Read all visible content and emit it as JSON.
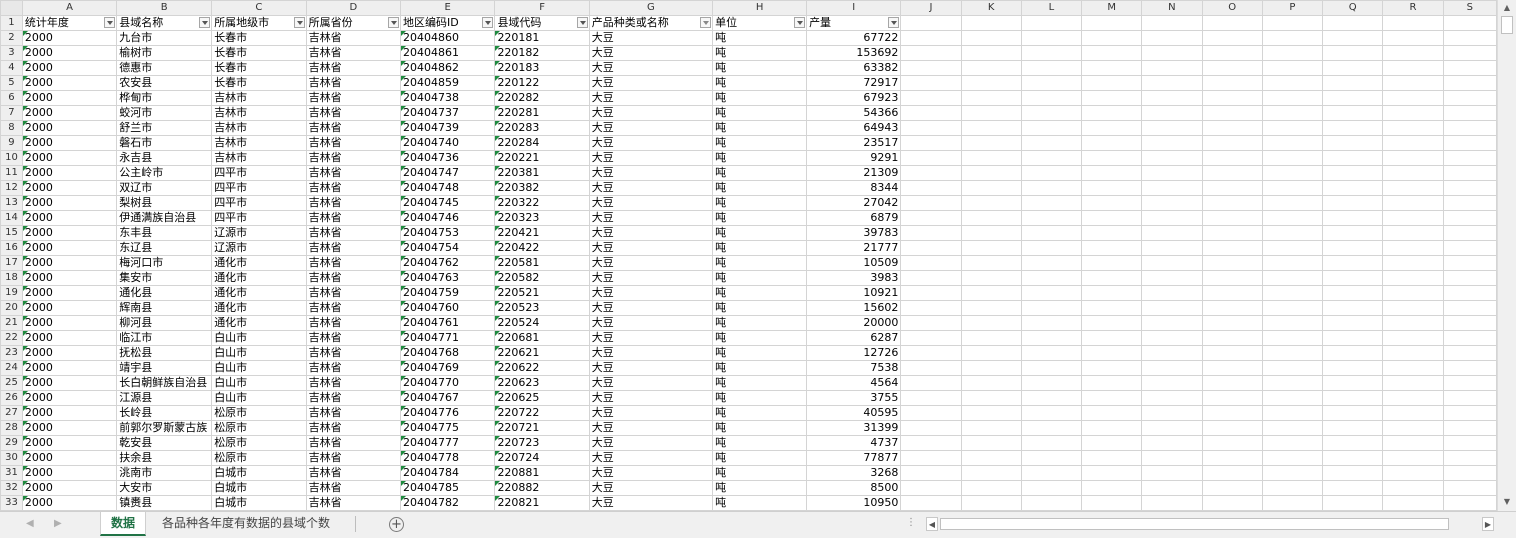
{
  "columns": [
    "A",
    "B",
    "C",
    "D",
    "E",
    "F",
    "G",
    "H",
    "I",
    "J",
    "K",
    "L",
    "M",
    "N",
    "O",
    "P",
    "Q",
    "R",
    "S"
  ],
  "headers": [
    "统计年度",
    "县域名称",
    "所属地级市",
    "所属省份",
    "地区编码ID",
    "县域代码",
    "产品种类或名称",
    "单位",
    "产量"
  ],
  "header_row_number": "1",
  "rows": [
    [
      "2",
      "2000",
      "九台市",
      "长春市",
      "吉林省",
      "20404860",
      "220181",
      "大豆",
      "吨",
      "67722"
    ],
    [
      "3",
      "2000",
      "榆树市",
      "长春市",
      "吉林省",
      "20404861",
      "220182",
      "大豆",
      "吨",
      "153692"
    ],
    [
      "4",
      "2000",
      "德惠市",
      "长春市",
      "吉林省",
      "20404862",
      "220183",
      "大豆",
      "吨",
      "63382"
    ],
    [
      "5",
      "2000",
      "农安县",
      "长春市",
      "吉林省",
      "20404859",
      "220122",
      "大豆",
      "吨",
      "72917"
    ],
    [
      "6",
      "2000",
      "桦甸市",
      "吉林市",
      "吉林省",
      "20404738",
      "220282",
      "大豆",
      "吨",
      "67923"
    ],
    [
      "7",
      "2000",
      "蛟河市",
      "吉林市",
      "吉林省",
      "20404737",
      "220281",
      "大豆",
      "吨",
      "54366"
    ],
    [
      "8",
      "2000",
      "舒兰市",
      "吉林市",
      "吉林省",
      "20404739",
      "220283",
      "大豆",
      "吨",
      "64943"
    ],
    [
      "9",
      "2000",
      "磐石市",
      "吉林市",
      "吉林省",
      "20404740",
      "220284",
      "大豆",
      "吨",
      "23517"
    ],
    [
      "10",
      "2000",
      "永吉县",
      "吉林市",
      "吉林省",
      "20404736",
      "220221",
      "大豆",
      "吨",
      "9291"
    ],
    [
      "11",
      "2000",
      "公主岭市",
      "四平市",
      "吉林省",
      "20404747",
      "220381",
      "大豆",
      "吨",
      "21309"
    ],
    [
      "12",
      "2000",
      "双辽市",
      "四平市",
      "吉林省",
      "20404748",
      "220382",
      "大豆",
      "吨",
      "8344"
    ],
    [
      "13",
      "2000",
      "梨树县",
      "四平市",
      "吉林省",
      "20404745",
      "220322",
      "大豆",
      "吨",
      "27042"
    ],
    [
      "14",
      "2000",
      "伊通满族自治县",
      "四平市",
      "吉林省",
      "20404746",
      "220323",
      "大豆",
      "吨",
      "6879"
    ],
    [
      "15",
      "2000",
      "东丰县",
      "辽源市",
      "吉林省",
      "20404753",
      "220421",
      "大豆",
      "吨",
      "39783"
    ],
    [
      "16",
      "2000",
      "东辽县",
      "辽源市",
      "吉林省",
      "20404754",
      "220422",
      "大豆",
      "吨",
      "21777"
    ],
    [
      "17",
      "2000",
      "梅河口市",
      "通化市",
      "吉林省",
      "20404762",
      "220581",
      "大豆",
      "吨",
      "10509"
    ],
    [
      "18",
      "2000",
      "集安市",
      "通化市",
      "吉林省",
      "20404763",
      "220582",
      "大豆",
      "吨",
      "3983"
    ],
    [
      "19",
      "2000",
      "通化县",
      "通化市",
      "吉林省",
      "20404759",
      "220521",
      "大豆",
      "吨",
      "10921"
    ],
    [
      "20",
      "2000",
      "辉南县",
      "通化市",
      "吉林省",
      "20404760",
      "220523",
      "大豆",
      "吨",
      "15602"
    ],
    [
      "21",
      "2000",
      "柳河县",
      "通化市",
      "吉林省",
      "20404761",
      "220524",
      "大豆",
      "吨",
      "20000"
    ],
    [
      "22",
      "2000",
      "临江市",
      "白山市",
      "吉林省",
      "20404771",
      "220681",
      "大豆",
      "吨",
      "6287"
    ],
    [
      "23",
      "2000",
      "抚松县",
      "白山市",
      "吉林省",
      "20404768",
      "220621",
      "大豆",
      "吨",
      "12726"
    ],
    [
      "24",
      "2000",
      "靖宇县",
      "白山市",
      "吉林省",
      "20404769",
      "220622",
      "大豆",
      "吨",
      "7538"
    ],
    [
      "25",
      "2000",
      "长白朝鲜族自治县",
      "白山市",
      "吉林省",
      "20404770",
      "220623",
      "大豆",
      "吨",
      "4564"
    ],
    [
      "26",
      "2000",
      "江源县",
      "白山市",
      "吉林省",
      "20404767",
      "220625",
      "大豆",
      "吨",
      "3755"
    ],
    [
      "27",
      "2000",
      "长岭县",
      "松原市",
      "吉林省",
      "20404776",
      "220722",
      "大豆",
      "吨",
      "40595"
    ],
    [
      "28",
      "2000",
      "前郭尔罗斯蒙古族",
      "松原市",
      "吉林省",
      "20404775",
      "220721",
      "大豆",
      "吨",
      "31399"
    ],
    [
      "29",
      "2000",
      "乾安县",
      "松原市",
      "吉林省",
      "20404777",
      "220723",
      "大豆",
      "吨",
      "4737"
    ],
    [
      "30",
      "2000",
      "扶余县",
      "松原市",
      "吉林省",
      "20404778",
      "220724",
      "大豆",
      "吨",
      "77877"
    ],
    [
      "31",
      "2000",
      "洮南市",
      "白城市",
      "吉林省",
      "20404784",
      "220881",
      "大豆",
      "吨",
      "3268"
    ],
    [
      "32",
      "2000",
      "大安市",
      "白城市",
      "吉林省",
      "20404785",
      "220882",
      "大豆",
      "吨",
      "8500"
    ],
    [
      "33",
      "2000",
      "镇赉县",
      "白城市",
      "吉林省",
      "20404782",
      "220821",
      "大豆",
      "吨",
      "10950"
    ]
  ],
  "sheet_tabs": {
    "active": "数据",
    "inactive": "各品种各年度有数据的县域个数"
  },
  "icons": {
    "add_sheet": "plus-circle-icon",
    "filter": "filter-dropdown-icon",
    "scroll_up": "arrow-up-icon",
    "scroll_down": "arrow-down-icon",
    "scroll_left": "arrow-left-icon",
    "scroll_right": "arrow-right-icon"
  },
  "colors": {
    "accent": "#217346",
    "text_indicator": "#1e8a3e"
  }
}
